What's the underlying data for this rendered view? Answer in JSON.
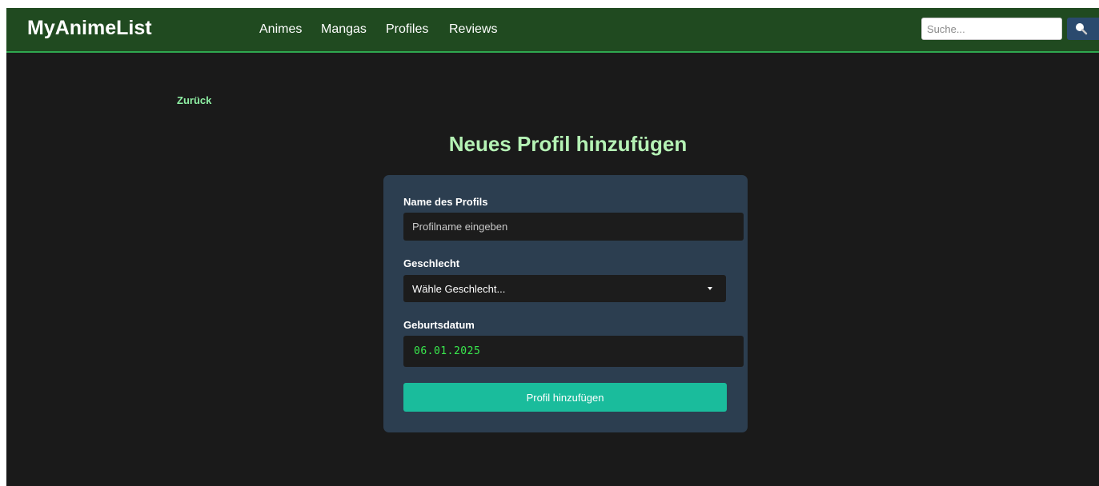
{
  "header": {
    "brand": "MyAnimeList",
    "nav": [
      {
        "label": "Animes"
      },
      {
        "label": "Mangas"
      },
      {
        "label": "Profiles"
      },
      {
        "label": "Reviews"
      }
    ],
    "search": {
      "placeholder": "Suche...",
      "value": "",
      "button_icon": "search-icon"
    }
  },
  "main": {
    "back_label": "Zurück",
    "title": "Neues Profil hinzufügen",
    "form": {
      "name_label": "Name des Profils",
      "name_placeholder": "Profilname eingeben",
      "name_value": "",
      "gender_label": "Geschlecht",
      "gender_selected": "Wähle Geschlecht...",
      "birthdate_label": "Geburtsdatum",
      "birthdate_value": "06.01.2025",
      "submit_label": "Profil hinzufügen"
    }
  },
  "colors": {
    "navbar_bg": "#204a20",
    "navbar_border": "#2fa84f",
    "page_bg": "#1a1a1a",
    "card_bg": "#2c3e50",
    "title": "#b5f2b5",
    "back_link": "#8ff0a4",
    "date_text": "#39e84d",
    "submit_bg": "#1abc9c",
    "search_button_bg": "#2b4a6e"
  }
}
